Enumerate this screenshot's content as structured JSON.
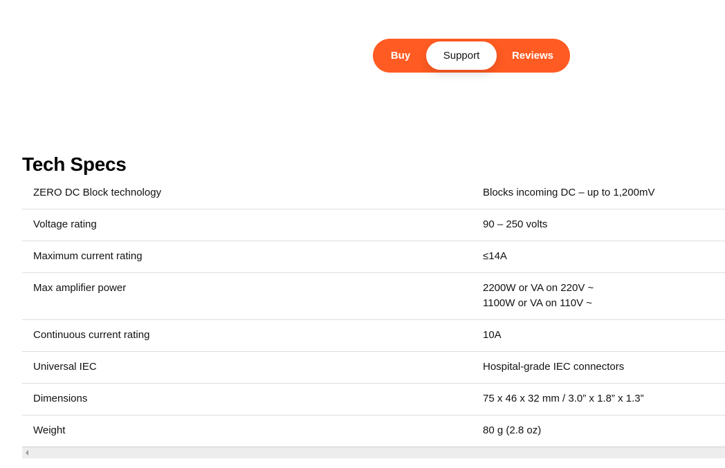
{
  "nav": {
    "tabs": [
      {
        "label": "Buy"
      },
      {
        "label": "Support"
      },
      {
        "label": "Reviews"
      }
    ],
    "active": "Support",
    "accent_color": "#ff5b22"
  },
  "tech_specs": {
    "title": "Tech Specs",
    "rows": [
      {
        "label": "ZERO DC Block technology",
        "value": "Blocks incoming DC – up to 1,200mV"
      },
      {
        "label": "Voltage rating",
        "value": "90 – 250 volts"
      },
      {
        "label": "Maximum current rating",
        "value": "≤14A"
      },
      {
        "label": "Max amplifier power",
        "value": "2200W or VA on 220V ~",
        "value2": "1100W or VA on 110V ~"
      },
      {
        "label": "Continuous current rating",
        "value": "10A"
      },
      {
        "label": "Universal IEC",
        "value": "Hospital-grade IEC connectors"
      },
      {
        "label": "Dimensions",
        "value": "75 x 46 x 32 mm / 3.0” x 1.8” x 1.3”"
      },
      {
        "label": "Weight",
        "value": "80 g (2.8 oz)"
      }
    ]
  }
}
